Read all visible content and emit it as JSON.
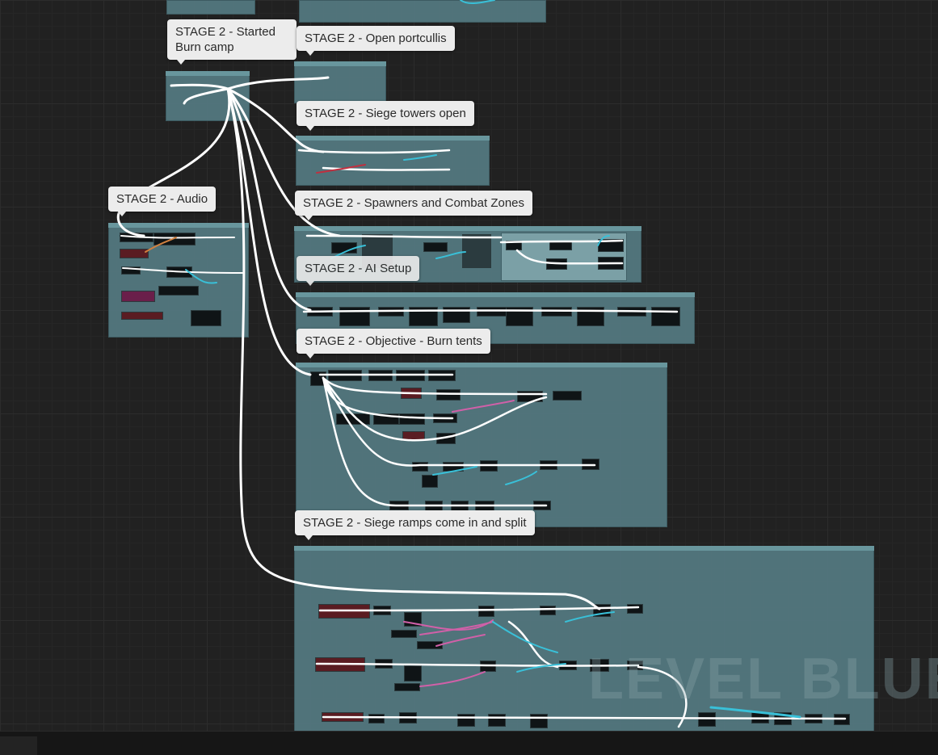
{
  "comments": [
    {
      "id": "burn-camp",
      "title": "STAGE 2 - Started\nBurn camp"
    },
    {
      "id": "portcullis",
      "title": "STAGE 2 - Open portcullis"
    },
    {
      "id": "siege-towers",
      "title": "STAGE 2 - Siege towers open"
    },
    {
      "id": "audio",
      "title": "STAGE 2 - Audio"
    },
    {
      "id": "spawners",
      "title": "STAGE 2 - Spawners and Combat Zones"
    },
    {
      "id": "ai-setup",
      "title": "STAGE 2 - AI Setup"
    },
    {
      "id": "burn-tents",
      "title": "STAGE 2 - Objective - Burn tents"
    },
    {
      "id": "siege-ramps",
      "title": "STAGE 2 - Siege ramps come in and split"
    }
  ],
  "watermark": "LEVEL BLUEP",
  "colors": {
    "canvas": "#212121",
    "comment_fill": "#557a82",
    "wire_exec": "#ffffff",
    "wire_cyan": "#39c0d8",
    "wire_pink": "#d060a8",
    "wire_red": "#c03040"
  }
}
